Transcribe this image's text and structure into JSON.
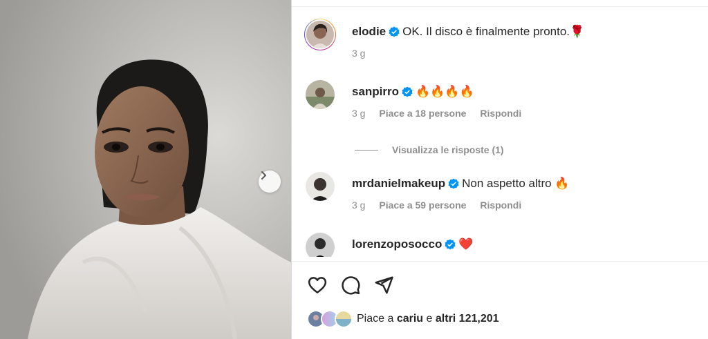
{
  "post": {
    "photo_alt": "woman in white bathrobe",
    "next_icon": "chevron-right-icon"
  },
  "caption": {
    "username": "elodie",
    "text": "OK. Il disco è finalmente pronto.🌹",
    "time": "3 g"
  },
  "comments": [
    {
      "username": "sanpirro",
      "text": "🔥🔥🔥🔥",
      "time": "3 g",
      "likes": "Piace a 18 persone",
      "reply": "Rispondi"
    },
    {
      "username": "mrdanielmakeup",
      "text": "Non aspetto altro 🔥",
      "time": "3 g",
      "likes": "Piace a 59 persone",
      "reply": "Rispondi"
    },
    {
      "username": "lorenzoposocco",
      "text": "❤️",
      "time": "",
      "likes": "",
      "reply": ""
    }
  ],
  "view_replies": "Visualizza le risposte (1)",
  "actions": [
    "heart-icon",
    "comment-icon",
    "share-icon"
  ],
  "likes_summary": {
    "prefix": "Piace a ",
    "user": "cariu",
    "middle": " e ",
    "others": "altri 121,201"
  },
  "colors": {
    "verified": "#0095f6",
    "meta": "#8e8e8e",
    "text": "#262626"
  }
}
